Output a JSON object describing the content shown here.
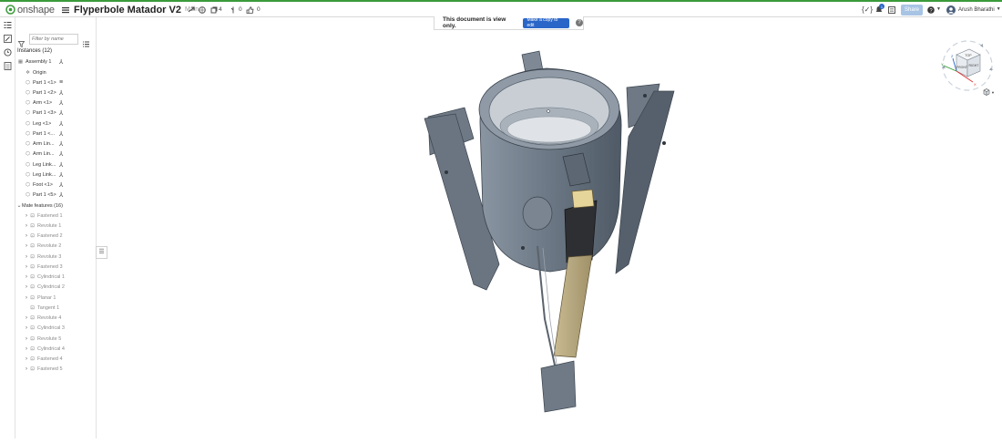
{
  "topbar": {
    "logo": "onshape",
    "doc_title": "Flyperbole Matador V2",
    "branch": "Main",
    "versions_count": "4",
    "branches_count": "0",
    "likes_count": "0",
    "notif_count": "1",
    "share_label": "Share",
    "user_name": "Arush Bharathi"
  },
  "banner": {
    "message": "This document is view only.",
    "copy_label": "Make a copy to edit",
    "help": "?"
  },
  "panel": {
    "filter_placeholder": "Filter by name",
    "instances_title": "Instances (12)",
    "assembly": "Assembly 1",
    "origin": "Origin",
    "instances": [
      "Part 1 <1>",
      "Part 1 <2>",
      "Arm <1>",
      "Part 1 <3>",
      "Leg <1>",
      "Part 1 <...",
      "Arm Lin...",
      "Arm Lin...",
      "Leg Link...",
      "Leg Link...",
      "Foot <1>",
      "Part 1 <5>"
    ],
    "mates_title": "Mate features (16)",
    "mates": [
      "Fastened 1",
      "Revolute 1",
      "Fastened 2",
      "Revolute 2",
      "Revolute 3",
      "Fastened 3",
      "Cylindrical 1",
      "Cylindrical 2",
      "Planar 1",
      "Tangent 1",
      "Revolute 4",
      "Cylindrical 3",
      "Revolute 5",
      "Cylindrical 4",
      "Fastened 4",
      "Fastened 5"
    ]
  },
  "viewcube": {
    "top": "TOP",
    "front": "FRONT",
    "right": "RIGHT",
    "x": "X",
    "y": "Y",
    "z": "Z"
  },
  "colors": {
    "accent": "#2a66c8",
    "brand_green": "#3a9a3a",
    "model_gray": "#6b7784",
    "tan": "#b4a57e"
  },
  "icons": {
    "menu": "hamburger-icon",
    "link": "link-icon",
    "globe": "globe-icon",
    "versions": "versions-icon",
    "branch": "branch-icon",
    "like": "thumbs-up-icon",
    "notif": "bell-icon",
    "help": "help-icon"
  }
}
